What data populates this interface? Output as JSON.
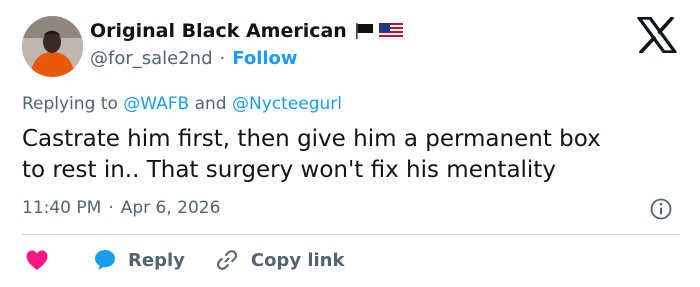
{
  "author": {
    "display_name": "Original Black American",
    "handle": "@for_sale2nd",
    "separator": "·",
    "follow_label": "Follow"
  },
  "reply_context": {
    "prefix": "Replying to",
    "mention_1": "@WAFB",
    "conjunction": "and",
    "mention_2": "@Nycteegurl"
  },
  "tweet": {
    "line_1": "Castrate him first, then give him a permanent box",
    "line_2": "to rest in.. That surgery won't fix his mentality"
  },
  "meta": {
    "time": "11:40 PM",
    "separator": "·",
    "date": "Apr 6, 2026"
  },
  "actions": {
    "reply_label": "Reply",
    "copy_link_label": "Copy link"
  },
  "colors": {
    "accent": "#1d9bf0",
    "like": "#f91880",
    "secondary_text": "#536471",
    "avatar_clothing": "#e8590c"
  },
  "icons": [
    "x-logo-icon",
    "black-flag-icon",
    "us-flag-icon",
    "info-icon",
    "heart-icon",
    "reply-bubble-icon",
    "link-icon"
  ]
}
